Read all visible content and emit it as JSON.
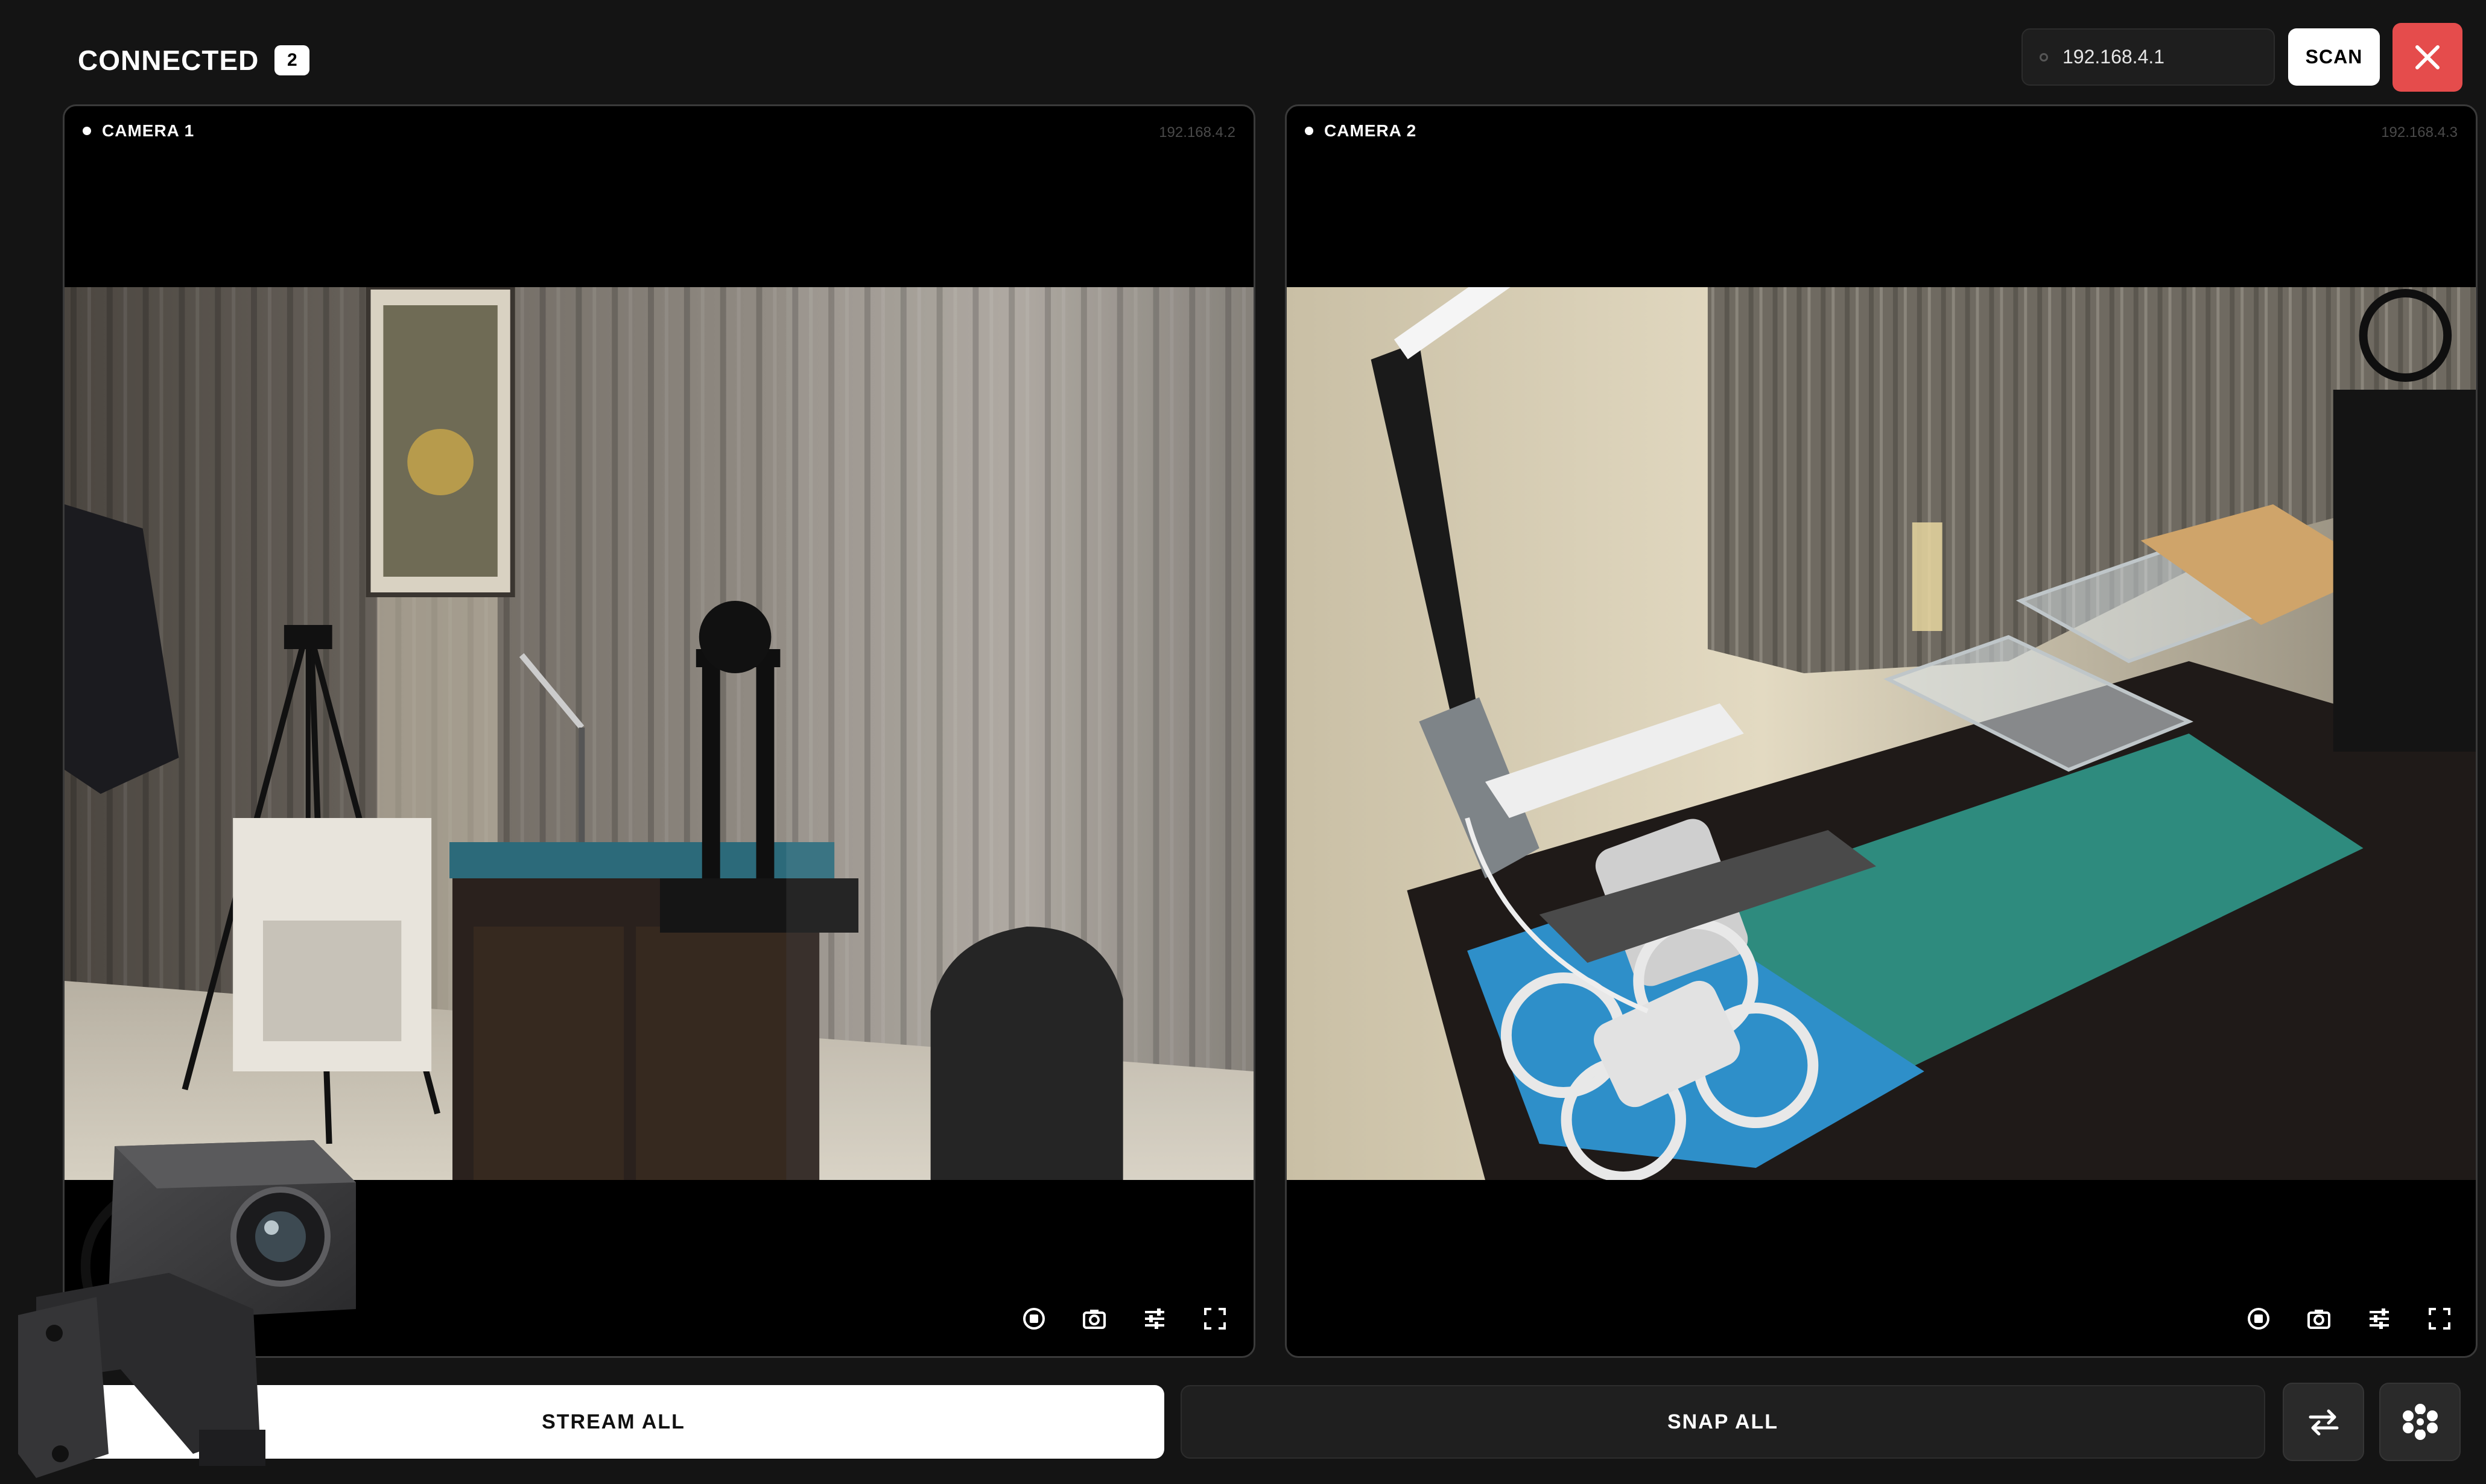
{
  "header": {
    "title": "CONNECTED",
    "connected_count": "2",
    "ip_input_value": "192.168.4.1",
    "scan_label": "SCAN",
    "close_icon": "close-icon"
  },
  "cameras": [
    {
      "label": "CAMERA 1",
      "ip": "192.168.4.2",
      "feed_description_icon": "camera-feed",
      "controls": [
        "record-icon",
        "snapshot-icon",
        "settings-sliders-icon",
        "fullscreen-icon"
      ]
    },
    {
      "label": "CAMERA 2",
      "ip": "192.168.4.3",
      "feed_description_icon": "camera-feed",
      "controls": [
        "record-icon",
        "snapshot-icon",
        "settings-sliders-icon",
        "fullscreen-icon"
      ]
    }
  ],
  "footer": {
    "stream_all_label": "STREAM ALL",
    "snap_all_label": "SNAP ALL",
    "swap_icon": "swap-arrows-icon",
    "gear_icon": "gear-icon"
  },
  "colors": {
    "background": "#141414",
    "panel": "#000000",
    "accent_close": "#e54c4c",
    "primary_button": "#ffffff"
  }
}
